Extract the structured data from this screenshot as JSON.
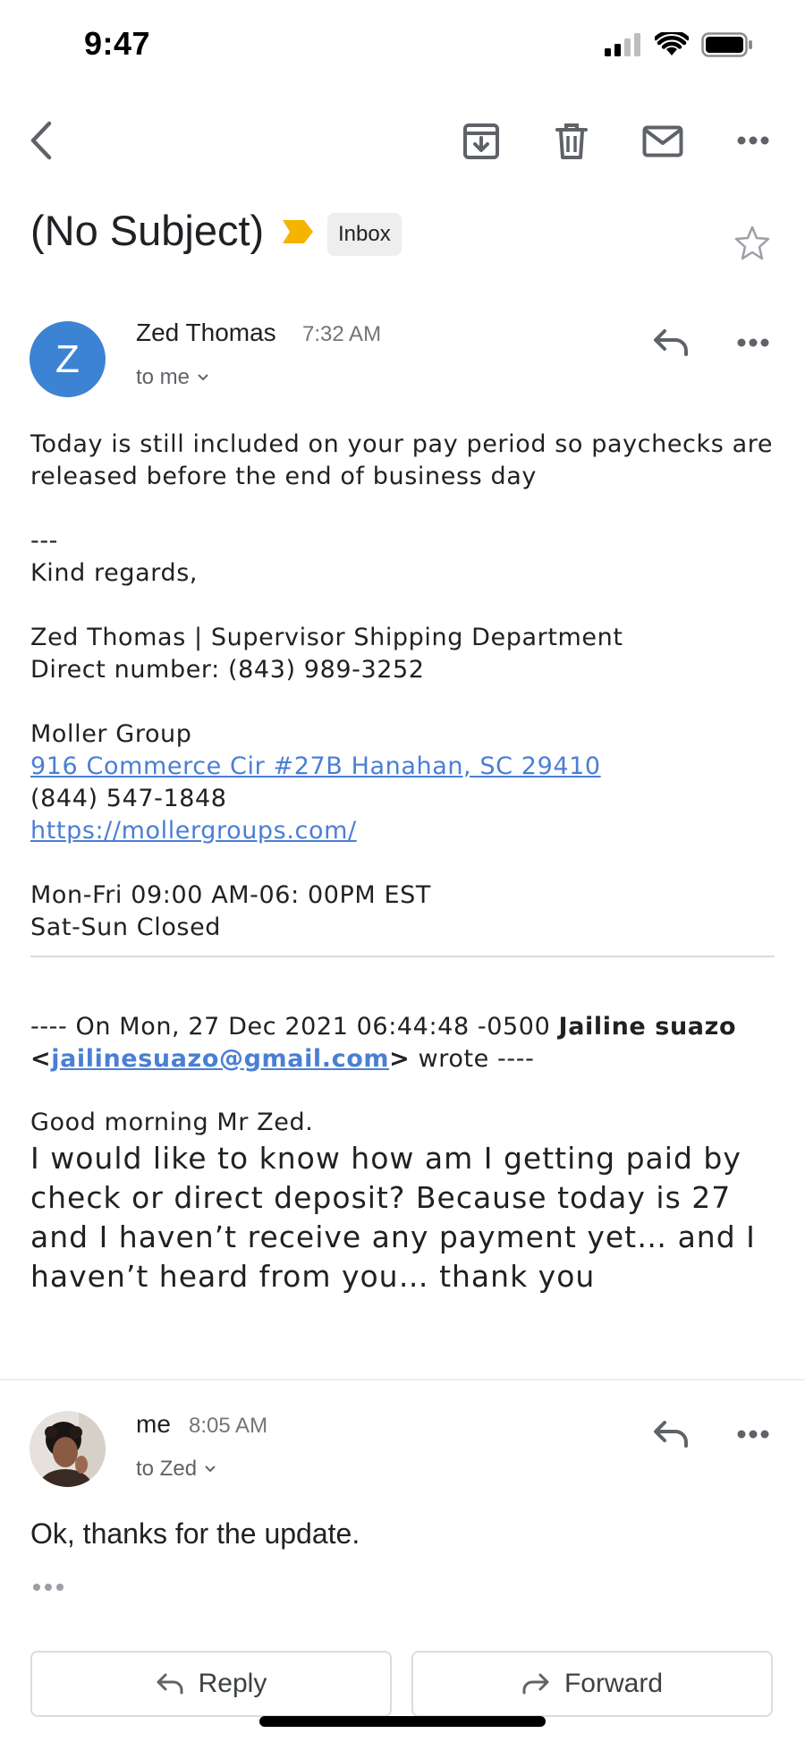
{
  "status_bar": {
    "time": "9:47"
  },
  "header": {
    "subject": "(No Subject)",
    "label": "Inbox"
  },
  "message1": {
    "avatar_letter": "Z",
    "sender": "Zed Thomas",
    "time": "7:32 AM",
    "to": "to me",
    "body": {
      "line1": "Today is still included on your pay period so paychecks are",
      "line2": "released before the end of business day",
      "sig_sep": "---",
      "regards": "Kind regards,",
      "name_title": "Zed Thomas | Supervisor Shipping Department",
      "direct": "Direct number: (843) 989-3252",
      "company": "Moller Group",
      "address": "916 Commerce Cir #27B Hanahan, SC 29410",
      "phone": "(844) 547-1848",
      "website": "https://mollergroups.com/",
      "hours1": "Mon-Fri 09:00 AM-06: 00PM EST",
      "hours2": "Sat-Sun Closed"
    },
    "quoted": {
      "header_prefix": "---- On Mon, 27 Dec 2021 06:44:48 -0500",
      "header_name": "Jailine suazo",
      "lt": "<",
      "email": "jailinesuazo@gmail.com",
      "gt": ">",
      "header_suffix": "wrote ----",
      "greeting": "Good morning Mr Zed.",
      "line1": "I would like to know how am I getting paid by",
      "line2": "check or direct deposit? Because today is 27",
      "line3": "and I haven’t receive any payment yet… and I",
      "line4": "haven’t heard from you… thank you"
    }
  },
  "message2": {
    "sender": "me",
    "time": "8:05 AM",
    "to": "to Zed",
    "body": "Ok, thanks for the update."
  },
  "actions": {
    "reply": "Reply",
    "forward": "Forward"
  },
  "colors": {
    "accent_blue": "#3d83d4",
    "link": "#4a7fd4",
    "label_yellow": "#f4b400"
  }
}
